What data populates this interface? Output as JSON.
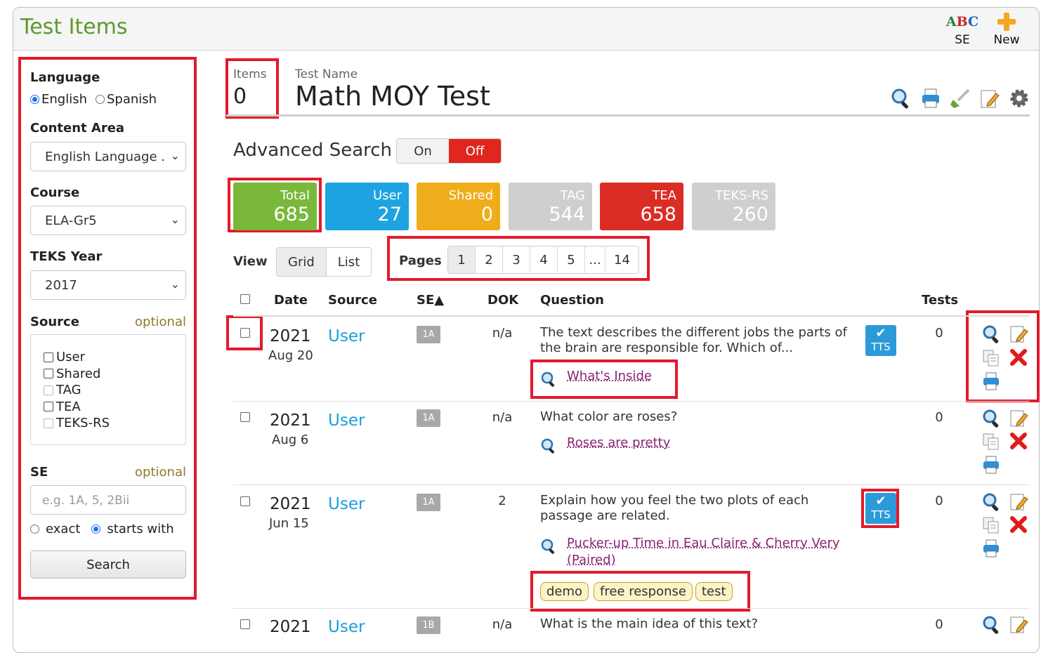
{
  "app": {
    "title": "Test Items"
  },
  "toolbar": {
    "se_label": "SE",
    "se_icon": "abc-spell-icon",
    "new_label": "New",
    "new_icon": "plus-icon"
  },
  "sidebar": {
    "language_heading": "Language",
    "language_options": [
      "English",
      "Spanish"
    ],
    "language_selected": "English",
    "content_area_heading": "Content Area",
    "content_area_value": "English Language .",
    "course_heading": "Course",
    "course_value": "ELA-Gr5",
    "teks_heading": "TEKS Year",
    "teks_value": "2017",
    "source_heading": "Source",
    "source_optional": "optional",
    "sources": [
      "User",
      "Shared",
      "TAG",
      "TEA",
      "TEKS-RS"
    ],
    "se_heading": "SE",
    "se_optional": "optional",
    "se_placeholder": "e.g. 1A, 5, 2Bii",
    "match_exact": "exact",
    "match_starts": "starts with",
    "match_selected": "starts with",
    "search_label": "Search"
  },
  "header": {
    "items_label": "Items",
    "items_count": "0",
    "test_name_label": "Test Name",
    "test_name": "Math MOY Test"
  },
  "advanced": {
    "label": "Advanced Search",
    "on": "On",
    "off": "Off",
    "state": "Off"
  },
  "stats": [
    {
      "label": "Total",
      "value": "685",
      "color": "#79b83a"
    },
    {
      "label": "User",
      "value": "27",
      "color": "#1ea3e0"
    },
    {
      "label": "Shared",
      "value": "0",
      "color": "#f0ad1b"
    },
    {
      "label": "TAG",
      "value": "544",
      "color": "#cfcfcf"
    },
    {
      "label": "TEA",
      "value": "658",
      "color": "#da2d24"
    },
    {
      "label": "TEKS-RS",
      "value": "260",
      "color": "#cfcfcf"
    }
  ],
  "view": {
    "label": "View",
    "grid": "Grid",
    "list": "List",
    "selected": "Grid"
  },
  "pages": {
    "label": "Pages",
    "items": [
      "1",
      "2",
      "3",
      "4",
      "5",
      "...",
      "14"
    ],
    "current": "1"
  },
  "table": {
    "columns": {
      "date": "Date",
      "source": "Source",
      "se": "SE▲",
      "dok": "DOK",
      "question": "Question",
      "tests": "Tests"
    },
    "rows": [
      {
        "year": "2021",
        "date": "Aug 20",
        "source": "User",
        "se": "1A",
        "dok": "n/a",
        "question": "The text describes the different jobs the parts of the brain are responsible for. Which of...",
        "passage": "What's Inside",
        "tts": "TTS",
        "tests": "0"
      },
      {
        "year": "2021",
        "date": "Aug 6",
        "source": "User",
        "se": "1A",
        "dok": "n/a",
        "question": "What color are roses?",
        "passage": "Roses are pretty",
        "tests": "0"
      },
      {
        "year": "2021",
        "date": "Jun 15",
        "source": "User",
        "se": "1A",
        "dok": "2",
        "question": "Explain how you feel the two plots of each passage are related.",
        "passage": "Pucker-up Time in Eau Claire & Cherry Very (Paired)",
        "tts": "TTS",
        "tests": "0",
        "tags": [
          "demo",
          "free response",
          "test"
        ]
      },
      {
        "year": "2021",
        "source": "User",
        "se": "1B",
        "dok": "n/a",
        "question": "What is the main idea of this text?",
        "tests": "0"
      }
    ]
  }
}
